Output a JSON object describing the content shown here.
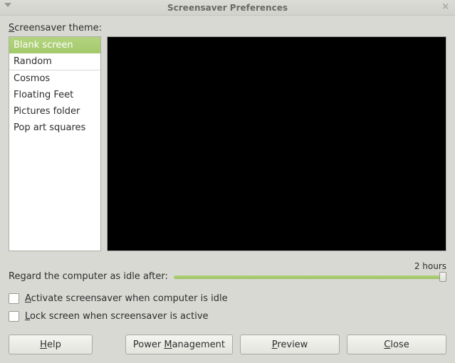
{
  "window": {
    "title": "Screensaver Preferences"
  },
  "theme": {
    "label_pre": "S",
    "label_post": "creensaver theme:",
    "items": [
      {
        "label": "Blank screen",
        "selected": true
      },
      {
        "label": "Random",
        "selected": false
      },
      {
        "label": "Cosmos",
        "selected": false
      },
      {
        "label": "Floating Feet",
        "selected": false
      },
      {
        "label": "Pictures folder",
        "selected": false
      },
      {
        "label": "Pop art squares",
        "selected": false
      }
    ]
  },
  "idle": {
    "label": "Regard the computer as idle after:",
    "value_text": "2 hours"
  },
  "checks": {
    "activate_pre": "A",
    "activate_post": "ctivate screensaver when computer is idle",
    "activate_checked": false,
    "lock_pre": "L",
    "lock_post": "ock screen when screensaver is active",
    "lock_checked": false
  },
  "buttons": {
    "help_pre": "H",
    "help_post": "elp",
    "power_pre": "Power ",
    "power_u": "M",
    "power_post": "anagement",
    "preview_pre": "P",
    "preview_post": "review",
    "close_pre": "C",
    "close_post": "lose"
  }
}
